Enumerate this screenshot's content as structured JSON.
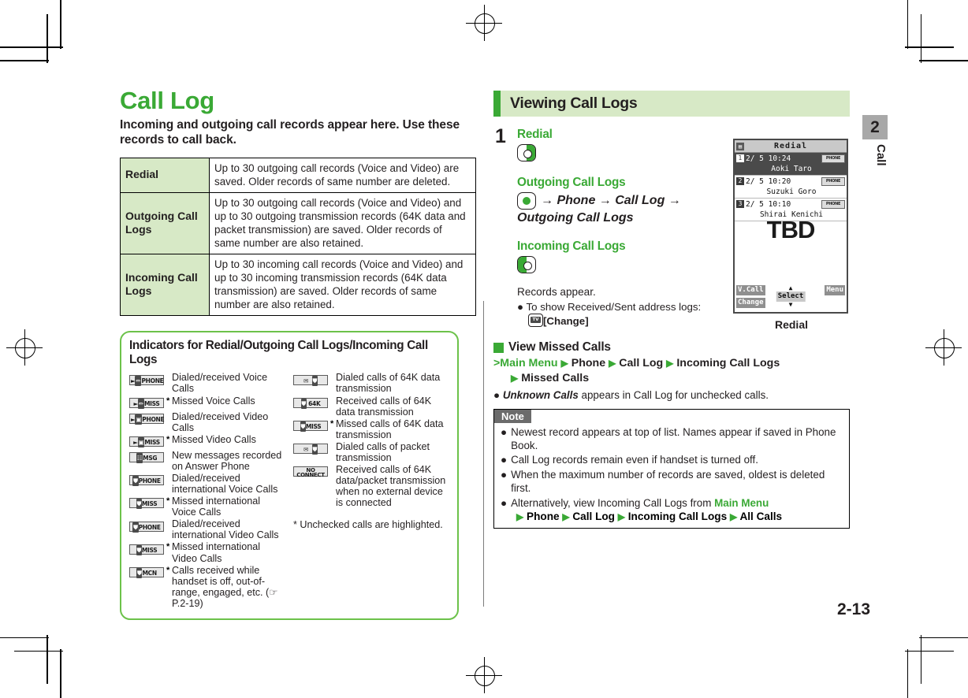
{
  "page": {
    "number": "2-13",
    "chapter_tab": "2",
    "chapter_label": "Call"
  },
  "left": {
    "title": "Call Log",
    "lead": "Incoming and outgoing call records appear here. Use these records to call back.",
    "spec_table": [
      {
        "key": "Redial",
        "value": "Up to 30 outgoing call records (Voice and Video) are saved. Older records of same number are deleted."
      },
      {
        "key": "Outgoing Call Logs",
        "value": "Up to 30 outgoing call records (Voice and Video) and up to 30 outgoing transmission records (64K data and packet transmission) are saved. Older records of same number are also retained."
      },
      {
        "key": "Incoming Call Logs",
        "value": "Up to 30 incoming call records (Voice and Video) and up to 30 incoming transmission records (64K data transmission) are saved. Older records of same number are also retained."
      }
    ],
    "indicators": {
      "heading": "Indicators for Redial/Outgoing Call Logs/Incoming Call Logs",
      "column_1": [
        {
          "icon": "phone-indicator-icon",
          "icon_text": "PHONE",
          "star": "",
          "label": "Dialed/received Voice Calls"
        },
        {
          "icon": "miss-indicator-icon",
          "icon_text": "MISS",
          "star": "*",
          "label": "Missed Voice Calls"
        },
        {
          "icon": "video-phone-indicator-icon",
          "icon_text": "PHONE",
          "star": "",
          "label": "Dialed/received Video Calls"
        },
        {
          "icon": "video-miss-indicator-icon",
          "icon_text": "MISS",
          "star": "*",
          "label": "Missed Video Calls"
        },
        {
          "icon": "msg-indicator-icon",
          "icon_text": "MSG",
          "star": "",
          "label": "New messages recorded on Answer Phone"
        },
        {
          "icon": "intl-phone-indicator-icon",
          "icon_text": "PHONE",
          "star": "",
          "label": "Dialed/received international Voice Calls"
        },
        {
          "icon": "intl-miss-indicator-icon",
          "icon_text": "MISS",
          "star": "*",
          "label": "Missed international Voice Calls"
        },
        {
          "icon": "intl-video-phone-indicator-icon",
          "icon_text": "PHONE",
          "star": "",
          "label": "Dialed/received international Video Calls"
        },
        {
          "icon": "intl-video-miss-indicator-icon",
          "icon_text": "MISS",
          "star": "*",
          "label": "Missed international Video Calls"
        },
        {
          "icon": "mcn-indicator-icon",
          "icon_text": "MCN",
          "star": "*",
          "label": "Calls received while handset is off, out-of-range, engaged, etc. (☞P.2-19)"
        }
      ],
      "column_2": [
        {
          "icon": "dialed-64k-indicator-icon",
          "icon_text": "",
          "star": "",
          "label": "Dialed calls of 64K data transmission"
        },
        {
          "icon": "received-64k-indicator-icon",
          "icon_text": "64K",
          "star": "",
          "label": "Received calls of 64K data transmission"
        },
        {
          "icon": "missed-64k-indicator-icon",
          "icon_text": "MISS",
          "star": "*",
          "label": "Missed calls of 64K data transmission"
        },
        {
          "icon": "dialed-packet-indicator-icon",
          "icon_text": "",
          "star": "",
          "label": "Dialed calls of packet transmission"
        },
        {
          "icon": "no-connect-indicator-icon",
          "icon_text": "NO CONNECT",
          "star": "",
          "label": "Received calls of 64K data/packet transmission when no external device is connected"
        }
      ],
      "footnote": "* Unchecked calls are highlighted."
    }
  },
  "right": {
    "section_title": "Viewing Call Logs",
    "step": {
      "number": "1",
      "redial_label": "Redial",
      "outgoing_label": "Outgoing Call Logs",
      "outgoing_path": "→ Phone → Call Log →",
      "outgoing_path_2": "Outgoing Call Logs",
      "incoming_label": "Incoming Call Logs",
      "records_appear": "Records appear.",
      "bullet": "To show Received/Sent address logs:",
      "bullet_key": "[Change]"
    },
    "phone": {
      "title": "Redial",
      "rows": [
        {
          "index": "1",
          "datetime": "2/ 5 10:24",
          "name": "Aoki Taro",
          "chip": "PHONE",
          "selected": true
        },
        {
          "index": "2",
          "datetime": "2/ 5 10:20",
          "name": "Suzuki Goro",
          "chip": "PHONE",
          "selected": false
        },
        {
          "index": "3",
          "datetime": "2/ 5 10:10",
          "name": "Shirai Kenichi",
          "chip": "PHONE",
          "selected": false
        }
      ],
      "overlay": "TBD",
      "softkey_left_top": "V.Call",
      "softkey_left_bottom": "Change",
      "softkey_center": "Select",
      "softkey_right": "Menu",
      "caption": "Redial"
    },
    "view_missed": {
      "heading": "View Missed Calls",
      "path_1": "Main Menu",
      "path_2": "Phone",
      "path_3": "Call Log",
      "path_4": "Incoming Call Logs",
      "path_5": "Missed Calls",
      "note_italic": "Unknown Calls",
      "note_rest": " appears in Call Log for unchecked calls."
    },
    "note": {
      "header": "Note",
      "items": [
        "Newest record appears at top of list. Names appear if saved in Phone Book.",
        "Call Log records remain even if handset is turned off.",
        "When the maximum number of records are saved, oldest is deleted first."
      ],
      "last_item_pre": "Alternatively, view Incoming Call Logs from ",
      "last_item_green": "Main Menu",
      "last_path_1": "Phone",
      "last_path_2": "Call Log",
      "last_path_3": "Incoming Call Logs",
      "last_path_4": "All Calls"
    }
  },
  "colors": {
    "brand_green": "#3aa935",
    "light_green": "#d7e9c6",
    "box_green": "#6cc24a",
    "note_gray": "#6b6b6b"
  }
}
